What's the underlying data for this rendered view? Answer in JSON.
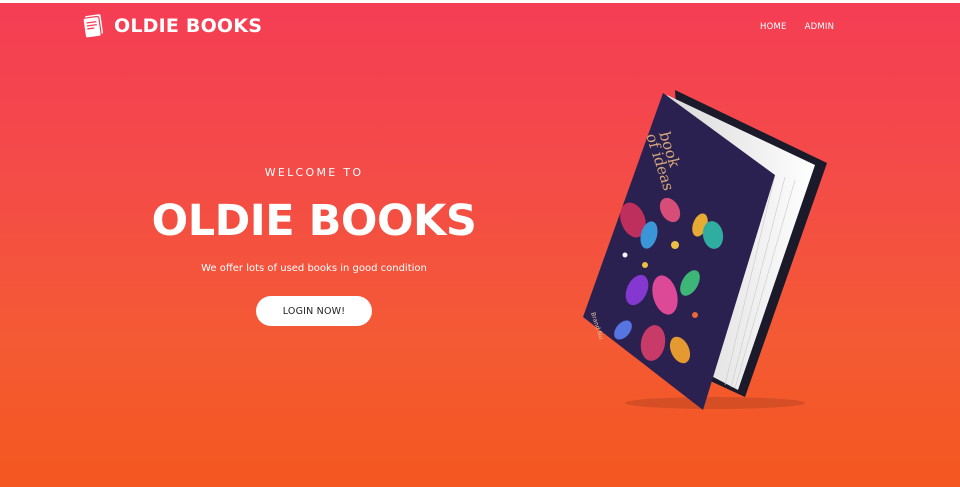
{
  "header": {
    "logo_text": "OLDIE BOOKS",
    "logo_icon": "book-icon",
    "nav": [
      {
        "label": "HOME"
      },
      {
        "label": "ADMIN"
      }
    ]
  },
  "hero": {
    "welcome": "WELCOME TO",
    "title": "OLDIE BOOKS",
    "subtitle": "We offer lots of used books in good condition",
    "cta_label": "LOGIN NOW!"
  },
  "book_image": {
    "cover_title": "book of ideas",
    "author": "Brand Nu"
  },
  "colors": {
    "gradient_top": "#f53d55",
    "gradient_bottom": "#f4571f",
    "button_bg": "#ffffff",
    "book_cover": "#2a2150"
  }
}
